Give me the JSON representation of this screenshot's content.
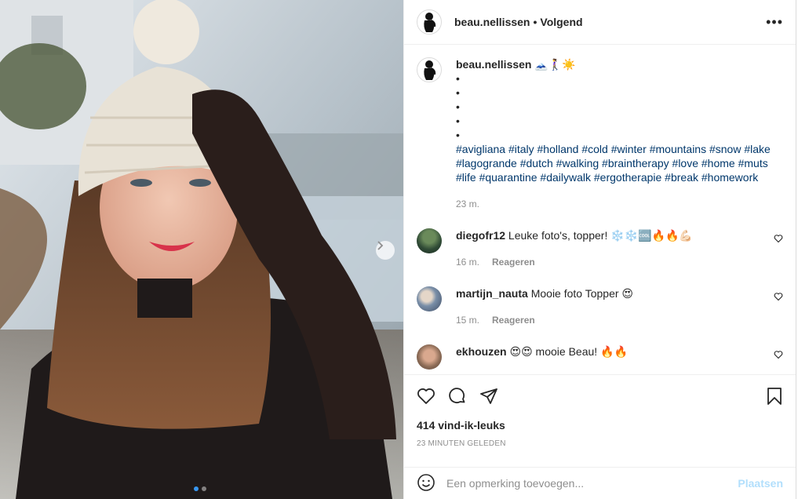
{
  "post": {
    "username": "beau.nellissen",
    "follow_state": "Volgend",
    "separator": "•",
    "more_label": "•••"
  },
  "caption": {
    "username": "beau.nellissen",
    "emoji": "🗻🚶‍♀️☀️",
    "bullets": [
      "•",
      "•",
      "•",
      "•",
      "•"
    ],
    "hashtags": "#avigliana #italy #holland #cold #winter #mountains #snow #lake #lagogrande #dutch #walking #braintherapy #love #home #muts #life #quarantine #dailywalk #ergotherapie #break #homework",
    "time": "23 m."
  },
  "comments": [
    {
      "username": "diegofr12",
      "text": "Leuke foto's, topper! ❄️❄️🆒🔥🔥💪🏻",
      "time": "16 m.",
      "reply": "Reageren"
    },
    {
      "username": "martijn_nauta",
      "text": "Mooie foto Topper 😍",
      "time": "15 m.",
      "reply": "Reageren"
    },
    {
      "username": "ekhouzen",
      "text": "😍😍 mooie Beau! 🔥🔥",
      "time": "",
      "reply": ""
    }
  ],
  "likes": "414 vind-ik-leuks",
  "posted_ago": "23 MINUTEN GELEDEN",
  "add_comment": {
    "placeholder": "Een opmerking toevoegen...",
    "post_label": "Plaatsen"
  },
  "icons": {
    "like": "heart-icon",
    "comment": "comment-icon",
    "share": "paper-plane-icon",
    "save": "bookmark-icon",
    "emoji": "smiley-icon",
    "next": "chevron-right-icon"
  },
  "colors": {
    "hashtag": "#00376b",
    "post_button_disabled": "#b2dffc",
    "active_dot": "#3897f0",
    "muted_text": "#8e8e8e"
  },
  "carousel": {
    "count": 2,
    "active_index": 0
  }
}
